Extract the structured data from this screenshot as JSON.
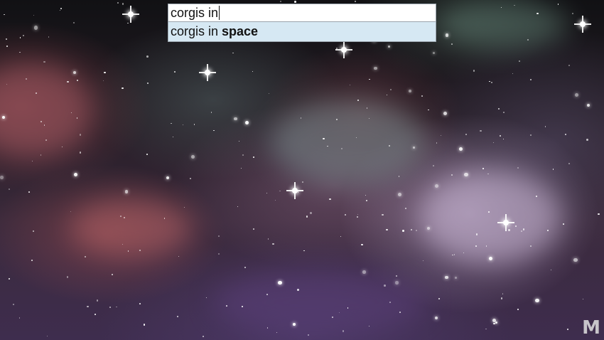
{
  "search": {
    "query": "corgis in",
    "suggestions": [
      {
        "prefix": "corgis in ",
        "completion": "space"
      }
    ]
  },
  "watermark": {
    "text": "M"
  },
  "colors": {
    "suggestion_highlight": "#d6e8f3",
    "input_border": "#9aa4ad"
  },
  "background": {
    "description_icon": "galaxy-nebula-background"
  }
}
